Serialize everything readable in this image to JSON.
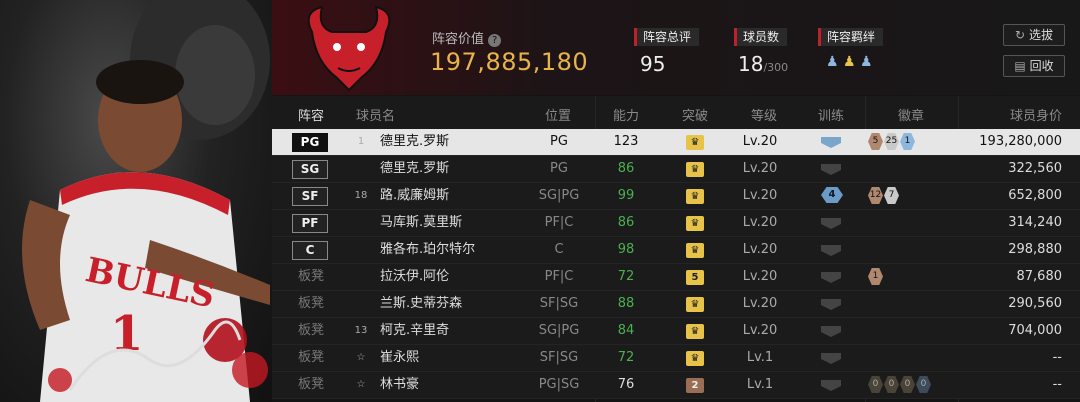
{
  "team": {
    "logo_text": "CHICAGO BULLS",
    "value_label": "阵容价值",
    "value": "197,885,180"
  },
  "stats": {
    "overall_label": "阵容总评",
    "overall": "95",
    "players_label": "球员数",
    "players": "18",
    "players_max": "/300",
    "chem_label": "阵容羁绊"
  },
  "buttons": {
    "select": "选拔",
    "recycle": "回收"
  },
  "columns": {
    "lineup": "阵容",
    "name": "球员名",
    "position": "位置",
    "rating": "能力",
    "breakthrough": "突破",
    "level": "等级",
    "training": "训练",
    "badges": "徽章",
    "value": "球员身价"
  },
  "rows": [
    {
      "slot": "PG",
      "slot_type": "starter",
      "jersey": "1",
      "name": "德里克.罗斯",
      "position": "PG",
      "rating": "123",
      "rating_color": "white",
      "break": "",
      "break_type": "gold",
      "level": "Lv.20",
      "training": "",
      "badges": [
        {
          "t": "5",
          "c": "brz"
        },
        {
          "t": "25",
          "c": "slv"
        },
        {
          "t": "1",
          "c": "blu"
        }
      ],
      "value": "193,280,000",
      "selected": true
    },
    {
      "slot": "SG",
      "slot_type": "starter",
      "jersey": "",
      "name": "德里克.罗斯",
      "position": "PG",
      "rating": "86",
      "rating_color": "green",
      "break": "",
      "break_type": "gold",
      "level": "Lv.20",
      "training": "",
      "badges": [],
      "value": "322,560"
    },
    {
      "slot": "SF",
      "slot_type": "starter",
      "jersey": "18",
      "name": "路.威廉姆斯",
      "position": "SG|PG",
      "rating": "99",
      "rating_color": "green",
      "break": "",
      "break_type": "gold",
      "level": "Lv.20",
      "training": "4",
      "badges": [
        {
          "t": "12",
          "c": "brz"
        },
        {
          "t": "7",
          "c": "slv"
        }
      ],
      "value": "652,800"
    },
    {
      "slot": "PF",
      "slot_type": "starter",
      "jersey": "",
      "name": "马库斯.莫里斯",
      "position": "PF|C",
      "rating": "86",
      "rating_color": "green",
      "break": "",
      "break_type": "gold",
      "level": "Lv.20",
      "training": "",
      "badges": [],
      "value": "314,240"
    },
    {
      "slot": "C",
      "slot_type": "starter",
      "jersey": "",
      "name": "雅各布.珀尔特尔",
      "position": "C",
      "rating": "98",
      "rating_color": "green",
      "break": "",
      "break_type": "gold",
      "level": "Lv.20",
      "training": "",
      "badges": [],
      "value": "298,880"
    },
    {
      "slot": "板凳",
      "slot_type": "bench",
      "jersey": "",
      "name": "拉沃伊.阿伦",
      "position": "PF|C",
      "rating": "72",
      "rating_color": "green",
      "break": "5",
      "break_type": "gold",
      "level": "Lv.20",
      "training": "",
      "badges": [
        {
          "t": "1",
          "c": "brz"
        }
      ],
      "value": "87,680"
    },
    {
      "slot": "板凳",
      "slot_type": "bench",
      "jersey": "",
      "name": "兰斯.史蒂芬森",
      "position": "SF|SG",
      "rating": "88",
      "rating_color": "green",
      "break": "",
      "break_type": "gold",
      "level": "Lv.20",
      "training": "",
      "badges": [],
      "value": "290,560"
    },
    {
      "slot": "板凳",
      "slot_type": "bench",
      "jersey": "13",
      "name": "柯克.辛里奇",
      "position": "SG|PG",
      "rating": "84",
      "rating_color": "green",
      "break": "",
      "break_type": "gold",
      "level": "Lv.20",
      "training": "",
      "badges": [],
      "value": "704,000"
    },
    {
      "slot": "板凳",
      "slot_type": "bench",
      "jersey": "☆",
      "name": "崔永熙",
      "position": "SF|SG",
      "rating": "72",
      "rating_color": "green",
      "break": "",
      "break_type": "gold",
      "level": "Lv.1",
      "training": "",
      "badges": [],
      "value": "--"
    },
    {
      "slot": "板凳",
      "slot_type": "bench",
      "jersey": "☆",
      "name": "林书豪",
      "position": "PG|SG",
      "rating": "76",
      "rating_color": "white",
      "break": "2",
      "break_type": "bronze",
      "level": "Lv.1",
      "training": "",
      "badges": [
        {
          "t": "0",
          "c": "dk"
        },
        {
          "t": "0",
          "c": "dk"
        },
        {
          "t": "0",
          "c": "dk"
        },
        {
          "t": "0",
          "c": "dkb"
        }
      ],
      "value": "--"
    }
  ]
}
